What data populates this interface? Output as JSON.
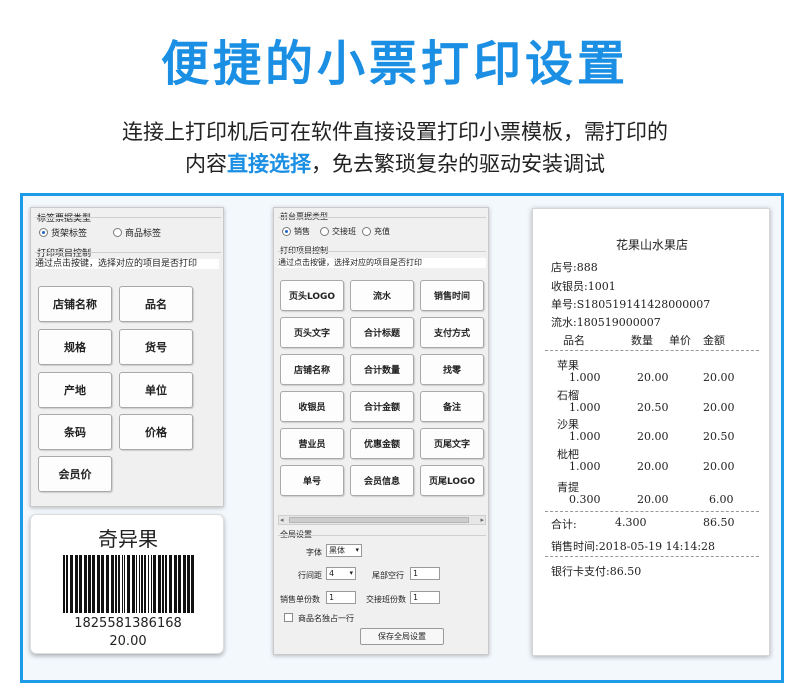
{
  "header": {
    "title": "便捷的小票打印设置",
    "line1": "连接上打印机后可在软件直接设置打印小票模板，需打印的",
    "line2_prefix": "内容",
    "line2_highlight": "直接选择",
    "line2_suffix": "，免去繁琐复杂的驱动安装调试"
  },
  "label_panel": {
    "type_group": "标签票据类型",
    "radio_shelf": "货架标签",
    "radio_product": "商品标签",
    "control_group": "打印项目控制",
    "hint": "通过点击按键，选择对应的项目是否打印",
    "buttons": [
      "店铺名称",
      "品名",
      "规格",
      "货号",
      "产地",
      "单位",
      "条码",
      "价格",
      "会员价"
    ]
  },
  "barcode_label": {
    "name": "奇异果",
    "code": "1825581386168",
    "price": "20.00"
  },
  "receipt_panel": {
    "type_group": "前台票据类型",
    "radio_sale": "销售",
    "radio_shift": "交接班",
    "radio_recharge": "充值",
    "control_group": "打印项目控制",
    "hint": "通过点击按键，选择对应的项目是否打印",
    "buttons": [
      "页头LOGO",
      "流水",
      "销售时间",
      "页头文字",
      "合计标题",
      "支付方式",
      "店铺名称",
      "合计数量",
      "找零",
      "收银员",
      "合计金额",
      "备注",
      "营业员",
      "优惠金额",
      "页尾文字",
      "单号",
      "会员信息",
      "页尾LOGO"
    ],
    "global_group": "全局设置",
    "font_label": "字体",
    "font_value": "黑体",
    "line_spacing_label": "行间距",
    "line_spacing_value": "4",
    "tail_blank_label": "尾部空行",
    "tail_blank_value": "1",
    "sale_copies_label": "销售单份数",
    "sale_copies_value": "1",
    "shift_copies_label": "交接班份数",
    "shift_copies_value": "1",
    "single_line_label": "商品名独占一行",
    "save_button": "保存全局设置"
  },
  "receipt": {
    "shop": "花果山水果店",
    "store_no": "店号:888",
    "cashier": "收银员:1001",
    "order_no": "单号:S180519141428000007",
    "serial": "流水:180519000007",
    "col_name": "品名",
    "col_qty": "数量",
    "col_price": "单价",
    "col_amount": "金额",
    "items": [
      {
        "name": "苹果",
        "qty": "1.000",
        "price": "20.00",
        "amount": "20.00"
      },
      {
        "name": "石榴",
        "qty": "1.000",
        "price": "20.50",
        "amount": "20.00"
      },
      {
        "name": "沙果",
        "qty": "1.000",
        "price": "20.00",
        "amount": "20.50"
      },
      {
        "name": "枇杷",
        "qty": "1.000",
        "price": "20.00",
        "amount": "20.00"
      },
      {
        "name": "青提",
        "qty": "0.300",
        "price": "20.00",
        "amount": "6.00"
      }
    ],
    "total_label": "合计:",
    "total_qty": "4.300",
    "total_amount": "86.50",
    "sale_time": "销售时间:2018-05-19 14:14:28",
    "bank_card": "银行卡支付:86.50"
  }
}
